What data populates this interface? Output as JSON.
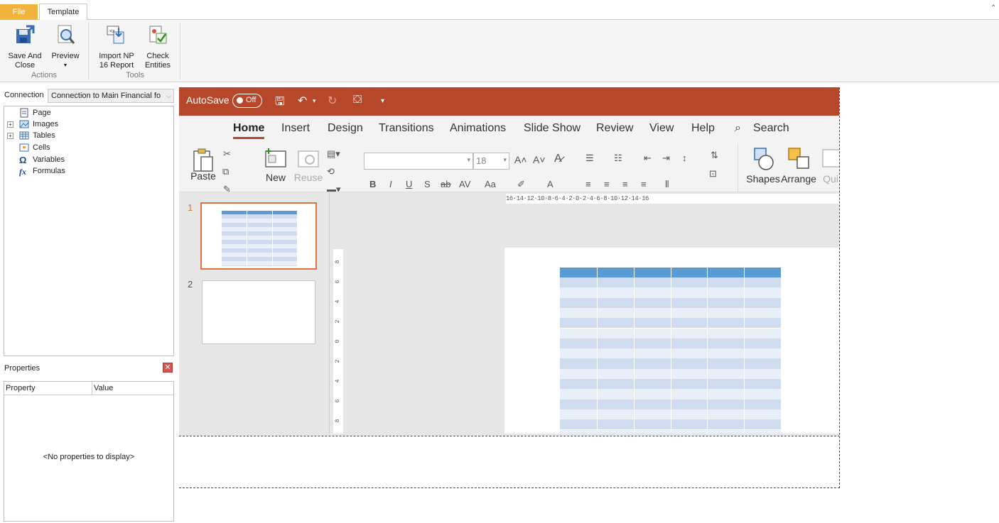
{
  "host": {
    "tabs": {
      "file": "File",
      "template": "Template"
    },
    "ribbon": {
      "save_close_line1": "Save And",
      "save_close_line2": "Close",
      "preview": "Preview",
      "import_line1": "Import NP",
      "import_line2": "16 Report",
      "check_line1": "Check",
      "check_line2": "Entities",
      "group_actions": "Actions",
      "group_tools": "Tools"
    },
    "connection": {
      "label": "Connection",
      "value": "Connection to Main Financial fo"
    },
    "tree": [
      {
        "label": "Page",
        "icon": "page-icon",
        "expandable": false
      },
      {
        "label": "Images",
        "icon": "images-icon",
        "expandable": true
      },
      {
        "label": "Tables",
        "icon": "tables-icon",
        "expandable": true
      },
      {
        "label": "Cells",
        "icon": "cells-icon",
        "expandable": false
      },
      {
        "label": "Variables",
        "icon": "omega-icon",
        "expandable": false
      },
      {
        "label": "Formulas",
        "icon": "fx-icon",
        "expandable": false
      }
    ],
    "properties": {
      "title": "Properties",
      "col_property": "Property",
      "col_value": "Value",
      "empty": "<No properties to display>"
    }
  },
  "ppt": {
    "autosave_label": "AutoSave",
    "autosave_state": "Off",
    "tabs": [
      "Home",
      "Insert",
      "Design",
      "Transitions",
      "Animations",
      "Slide Show",
      "Review",
      "View",
      "Help"
    ],
    "active_tab": "Home",
    "search": "Search",
    "ribbon": {
      "paste": "Paste",
      "new_slide": "New",
      "reuse": "Reuse",
      "font_size": "18",
      "shapes": "Shapes",
      "arrange": "Arrange",
      "quick_styles": "Qui"
    },
    "slides": [
      {
        "number": "1"
      },
      {
        "number": "2"
      }
    ],
    "ruler_h": "16·14·12·10·8·6·4·2·0·2·4·6·8·10·12·14·16",
    "colors": {
      "accent": "#b7472a",
      "table_header": "#5b9bd5",
      "row_dark": "#cfdcef",
      "row_light": "#e9eff7"
    }
  }
}
